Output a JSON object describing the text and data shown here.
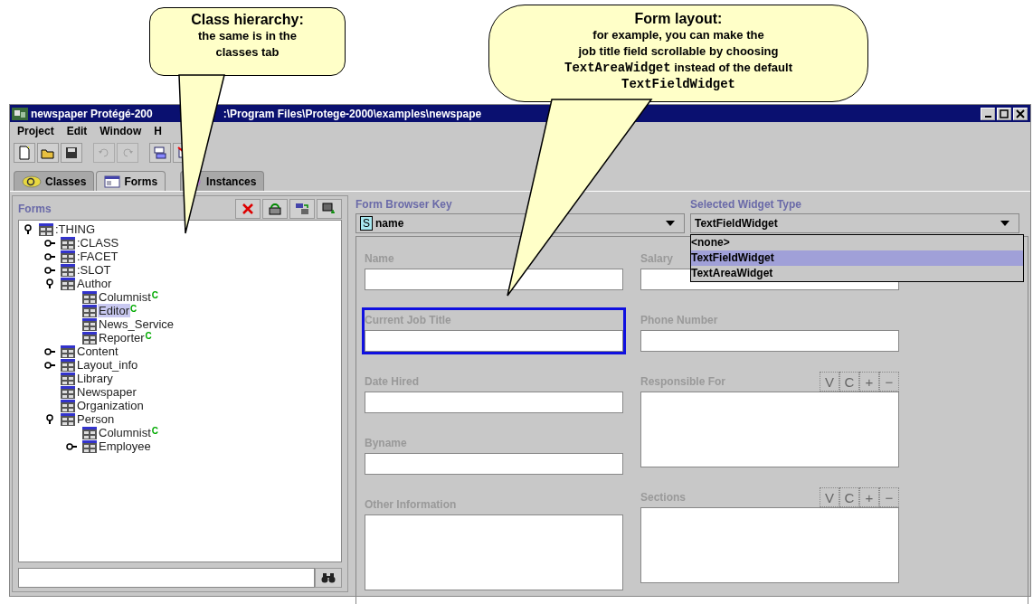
{
  "callouts": [
    {
      "title": "Class hierarchy:",
      "lines": [
        [
          {
            "text": "the same is in the",
            "kind": "plain"
          }
        ],
        [
          {
            "text": "classes tab",
            "kind": "plain"
          }
        ]
      ]
    },
    {
      "title": "Form layout:",
      "lines": [
        [
          {
            "text": "for example, you can make the",
            "kind": "plain"
          }
        ],
        [
          {
            "text": "job title field scrollable by choosing",
            "kind": "plain"
          }
        ],
        [
          {
            "text": "TextAreaWidget",
            "kind": "code"
          },
          {
            "text": " instead of the default",
            "kind": "plain"
          }
        ],
        [
          {
            "text": "TextFieldWidget",
            "kind": "code"
          }
        ]
      ]
    }
  ],
  "window": {
    "title_parts": [
      "newspaper  Protégé-200",
      ":\\Program Files\\Protege-2000\\examples\\newspape"
    ]
  },
  "menu": [
    "Project",
    "Edit",
    "Window",
    "H"
  ],
  "toolbar": [
    {
      "kind": "new",
      "disabled": false
    },
    {
      "kind": "open",
      "disabled": false
    },
    {
      "kind": "save",
      "disabled": false
    },
    {
      "kind": "undo",
      "disabled": true
    },
    {
      "kind": "redo",
      "disabled": true
    },
    {
      "kind": "cut",
      "disabled": false
    },
    {
      "kind": "delete",
      "disabled": false
    }
  ],
  "tabs": [
    {
      "label": "Classes",
      "kind": "classes",
      "selected": false
    },
    {
      "label": "Forms",
      "kind": "forms",
      "selected": true
    },
    {
      "label": "Instances",
      "kind": "instances",
      "selected": false
    }
  ],
  "forms_panel": {
    "title": "Forms",
    "tree": [
      {
        "label": ":THING",
        "expanded": true,
        "selected": false,
        "children": [
          {
            "label": ":CLASS",
            "expanded": false,
            "selected": false
          },
          {
            "label": ":FACET",
            "expanded": false,
            "selected": false
          },
          {
            "label": ":SLOT",
            "expanded": false,
            "selected": false
          },
          {
            "label": "Author",
            "expanded": true,
            "selected": false,
            "children": [
              {
                "label": "Columnist",
                "badge": "C",
                "selected": false
              },
              {
                "label": "Editor",
                "badge": "C",
                "selected": true
              },
              {
                "label": "News_Service",
                "selected": false
              },
              {
                "label": "Reporter",
                "badge": "C",
                "selected": false
              }
            ]
          },
          {
            "label": "Content",
            "expanded": false,
            "selected": false
          },
          {
            "label": "Layout_info",
            "expanded": false,
            "selected": false
          },
          {
            "label": "Library",
            "selected": false
          },
          {
            "label": "Newspaper",
            "selected": false
          },
          {
            "label": "Organization",
            "selected": false
          },
          {
            "label": "Person",
            "expanded": true,
            "selected": false,
            "children": [
              {
                "label": "Columnist",
                "badge": "C",
                "selected": false
              },
              {
                "label": "Employee",
                "expanded": false,
                "selected": false
              }
            ]
          }
        ]
      }
    ]
  },
  "form_panel": {
    "key_label": "Form Browser Key",
    "key_combo": {
      "badge": "S",
      "value": "name"
    },
    "widget_label": "Selected Widget Type",
    "widget_combo": {
      "value": "TextFieldWidget"
    },
    "widget_options": [
      {
        "label": "<none>",
        "selected": false
      },
      {
        "label": "TextFieldWidget",
        "selected": true
      },
      {
        "label": "TextAreaWidget",
        "selected": false
      }
    ],
    "columns": [
      [
        {
          "label": "Name",
          "kind": "text",
          "selected": false
        },
        {
          "label": "Current Job Title",
          "kind": "text",
          "selected": true
        },
        {
          "label": "Date Hired",
          "kind": "text",
          "selected": false
        },
        {
          "label": "Byname",
          "kind": "text",
          "selected": false
        },
        {
          "label": "Other Information",
          "kind": "textarea",
          "selected": false
        }
      ],
      [
        {
          "label": "Salary",
          "kind": "text",
          "selected": false
        },
        {
          "label": "Phone Number",
          "kind": "text",
          "selected": false
        },
        {
          "label": "Responsible For",
          "kind": "list",
          "buttons": [
            "V",
            "C",
            "+",
            "−"
          ],
          "selected": false
        },
        {
          "label": "Sections",
          "kind": "list",
          "buttons": [
            "V",
            "C",
            "+",
            "−"
          ],
          "selected": false
        }
      ]
    ]
  }
}
